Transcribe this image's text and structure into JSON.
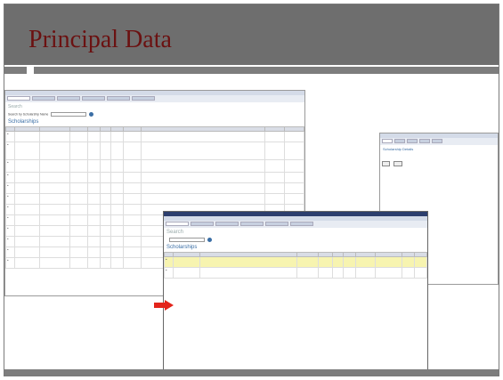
{
  "slide": {
    "title": "Principal Data"
  },
  "colors": {
    "header": "#6e6e6e",
    "title": "#6b1111",
    "arrow": "#e3241b",
    "highlight": "#f7f4b0"
  },
  "arrow": {
    "icon": "red-arrow-right-icon"
  },
  "screenshots": [
    {
      "name": "scholarship-list-screenshot",
      "section_title": "Scholarships"
    },
    {
      "name": "scholarship-search-screenshot",
      "section_title": "Search",
      "list_title": "Scholarships"
    },
    {
      "name": "scholarship-detail-screenshot",
      "section_title": "Scholarship Details",
      "lower_title": "Scholarship Criteria"
    }
  ]
}
